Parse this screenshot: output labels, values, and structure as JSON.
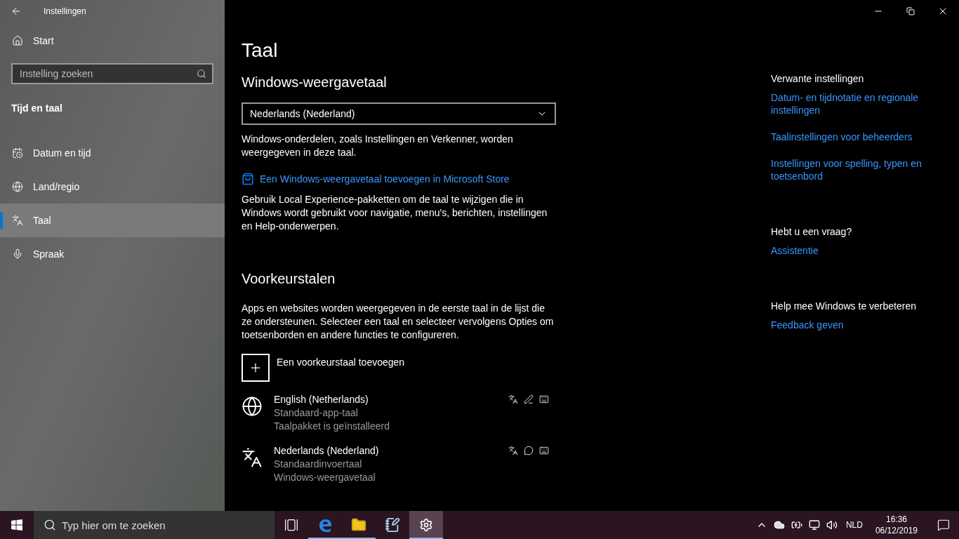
{
  "window": {
    "title": "Instellingen"
  },
  "sidebar": {
    "home": "Start",
    "search": {
      "placeholder": "Instelling zoeken"
    },
    "section": "Tijd en taal",
    "items": [
      {
        "kind": "datetime",
        "label": "Datum en tijd",
        "selected": false
      },
      {
        "kind": "region",
        "label": "Land/regio",
        "selected": false
      },
      {
        "kind": "language",
        "label": "Taal",
        "selected": true
      },
      {
        "kind": "speech",
        "label": "Spraak",
        "selected": false
      }
    ]
  },
  "page": {
    "title": "Taal",
    "display_language": {
      "heading": "Windows-weergavetaal",
      "dropdown": "Nederlands (Nederland)",
      "description": "Windows-onderdelen, zoals Instellingen en Verkenner, worden weergegeven in deze taal.",
      "store_link": "Een Windows-weergavetaal toevoegen in Microsoft Store",
      "note": "Gebruik Local Experience-pakketten om de taal te wijzigen die in Windows wordt gebruikt voor navigatie, menu's, berichten, instellingen en Help-onderwerpen."
    },
    "preferred": {
      "heading": "Voorkeurstalen",
      "description": "Apps en websites worden weergegeven in de eerste taal in de lijst die ze ondersteunen. Selecteer een taal en selecteer vervolgens Opties om toetsenborden en andere functies te configureren.",
      "add_button": "Een voorkeurstaal toevoegen",
      "languages": [
        {
          "kind": "globe",
          "name": "English (Netherlands)",
          "lines": [
            "Standaard-app-taal",
            "Taalpakket is geïnstalleerd"
          ],
          "features": [
            {
              "kind": "display"
            },
            {
              "kind": "handwriting"
            },
            {
              "kind": "keyboard"
            }
          ]
        },
        {
          "kind": "plain",
          "name": "Nederlands (Nederland)",
          "lines": [
            "Standaardinvoertaal",
            "Windows-weergavetaal"
          ],
          "features": [
            {
              "kind": "display"
            },
            {
              "kind": "speech"
            },
            {
              "kind": "keyboard"
            }
          ]
        }
      ]
    }
  },
  "related": [
    {
      "heading": "Verwante instellingen",
      "links": [
        "Datum- en tijdnotatie en regionale instellingen",
        "Taalinstellingen voor beheerders",
        "Instellingen voor spelling, typen en toetsenbord"
      ]
    },
    {
      "heading": "Hebt u een vraag?",
      "links": [
        "Assistentie"
      ]
    },
    {
      "heading": "Help mee Windows te verbeteren",
      "links": [
        "Feedback geven"
      ]
    }
  ],
  "taskbar": {
    "search": {
      "placeholder": "Typ hier om te zoeken"
    },
    "apps": [
      {
        "kind": "taskview",
        "running": false,
        "selected": false
      },
      {
        "kind": "edge",
        "running": true,
        "selected": false
      },
      {
        "kind": "explorer",
        "running": true,
        "selected": false
      },
      {
        "kind": "notepad",
        "running": false,
        "selected": false
      },
      {
        "kind": "settings",
        "running": true,
        "selected": true
      }
    ],
    "language": "NLD",
    "time": "16:36",
    "date": "06/12/2019"
  }
}
